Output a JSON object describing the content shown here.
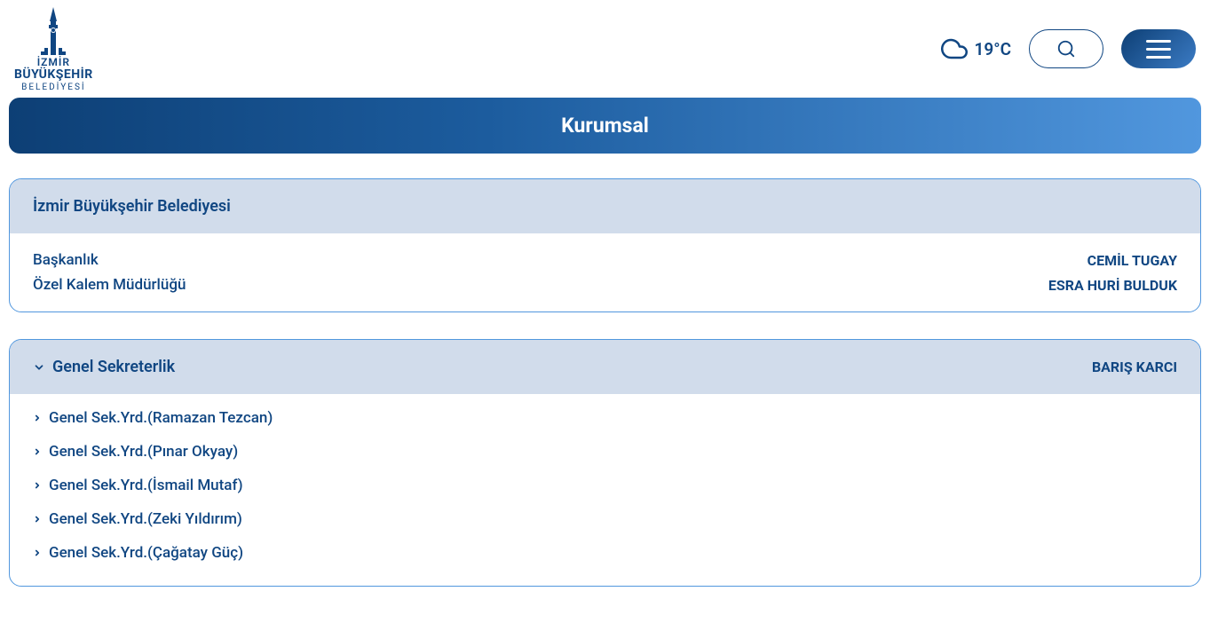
{
  "header": {
    "logo": {
      "line1": "İZMİR",
      "line2": "BÜYÜKŞEHİR",
      "line3": "BELEDİYESİ"
    },
    "weather": {
      "temperature": "19°C"
    }
  },
  "page_title": "Kurumsal",
  "municipality": {
    "title": "İzmir Büyükşehir Belediyesi",
    "rows": [
      {
        "label": "Başkanlık",
        "value": "CEMİL TUGAY"
      },
      {
        "label": "Özel Kalem Müdürlüğü",
        "value": "ESRA HURİ BULDUK"
      }
    ]
  },
  "secretariat": {
    "title": "Genel Sekreterlik",
    "head": "BARIŞ KARCI",
    "items": [
      {
        "label": "Genel Sek.Yrd.(Ramazan Tezcan)"
      },
      {
        "label": "Genel Sek.Yrd.(Pınar Okyay)"
      },
      {
        "label": "Genel Sek.Yrd.(İsmail Mutaf)"
      },
      {
        "label": "Genel Sek.Yrd.(Zeki Yıldırım)"
      },
      {
        "label": "Genel Sek.Yrd.(Çağatay Güç)"
      }
    ]
  }
}
